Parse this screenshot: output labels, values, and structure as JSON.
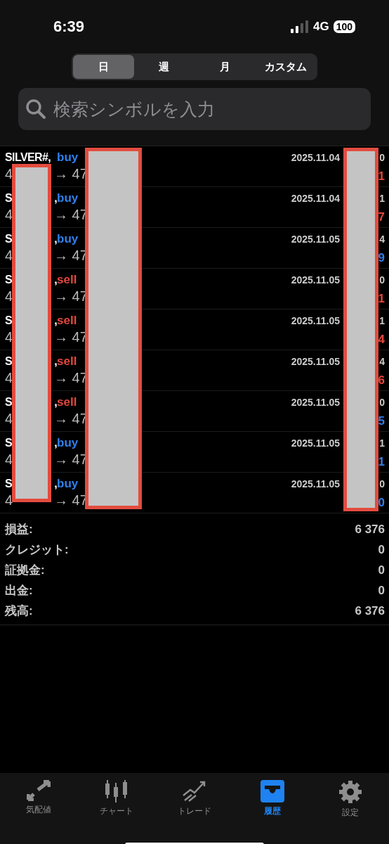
{
  "status_bar": {
    "time": "6:39",
    "network": "4G",
    "battery": "100"
  },
  "periods": [
    {
      "label": "日",
      "selected": true
    },
    {
      "label": "週",
      "selected": false
    },
    {
      "label": "月",
      "selected": false
    },
    {
      "label": "カスタム",
      "selected": false
    }
  ],
  "search": {
    "placeholder": "検索シンボルを入力"
  },
  "deals": [
    {
      "symbol_parts": [
        "SILVER#,"
      ],
      "type": "buy",
      "color": "#2f80ed",
      "open": "4",
      "close": "→ 47",
      "date": "2025.11.04",
      "time_tail": "0",
      "profit": {
        "text": "1",
        "color": "#e5483d"
      }
    },
    {
      "symbol_parts": [
        "S",
        ","
      ],
      "type": "buy",
      "color": "#2f80ed",
      "open": "4",
      "close": "→ 47",
      "date": "2025.11.04",
      "time_tail": "1",
      "profit": {
        "text": "7",
        "color": "#e5483d"
      }
    },
    {
      "symbol_parts": [
        "S",
        ","
      ],
      "type": "buy",
      "color": "#2f80ed",
      "open": "4",
      "close": "→ 47",
      "date": "2025.11.05",
      "time_tail": "4",
      "profit": {
        "text": "9",
        "color": "#2f80ed"
      }
    },
    {
      "symbol_parts": [
        "S",
        ","
      ],
      "type": "sell",
      "color": "#e5483d",
      "open": "4",
      "close": "→ 47",
      "date": "2025.11.05",
      "time_tail": "0",
      "profit": {
        "text": "1",
        "color": "#e5483d"
      }
    },
    {
      "symbol_parts": [
        "S",
        ","
      ],
      "type": "sell",
      "color": "#e5483d",
      "open": "4",
      "close": "→ 47",
      "date": "2025.11.05",
      "time_tail": "1",
      "profit": {
        "text": "4",
        "color": "#e5483d"
      }
    },
    {
      "symbol_parts": [
        "S",
        ","
      ],
      "type": "sell",
      "color": "#e5483d",
      "open": "4",
      "close": "→ 47",
      "date": "2025.11.05",
      "time_tail": "4",
      "profit": {
        "text": "6",
        "color": "#e5483d"
      }
    },
    {
      "symbol_parts": [
        "S",
        ","
      ],
      "type": "sell",
      "color": "#e5483d",
      "open": "4",
      "close": "→ 47",
      "date": "2025.11.05",
      "time_tail": "0",
      "profit": {
        "text": "5",
        "color": "#2f80ed"
      }
    },
    {
      "symbol_parts": [
        "S",
        ","
      ],
      "type": "buy",
      "color": "#2f80ed",
      "open": "4",
      "close": "→ 47",
      "date": "2025.11.05",
      "time_tail": "1",
      "profit": {
        "text": "1",
        "color": "#2f80ed"
      }
    },
    {
      "symbol_parts": [
        "S",
        ","
      ],
      "type": "buy",
      "color": "#2f80ed",
      "open": "4",
      "close": "→ 47",
      "date": "2025.11.05",
      "time_tail": "0",
      "profit": {
        "text": "0",
        "color": "#2f80ed"
      }
    }
  ],
  "summary": [
    {
      "label": "損益:",
      "value": "6 376"
    },
    {
      "label": "クレジット:",
      "value": "0"
    },
    {
      "label": "証拠金:",
      "value": "0"
    },
    {
      "label": "出金:",
      "value": "0"
    },
    {
      "label": "残高:",
      "value": "6 376"
    }
  ],
  "tab_bar": [
    {
      "label": "気配値",
      "selected": false
    },
    {
      "label": "チャート",
      "selected": false
    },
    {
      "label": "トレード",
      "selected": false
    },
    {
      "label": "履歴",
      "selected": true
    },
    {
      "label": "設定",
      "selected": false
    }
  ]
}
